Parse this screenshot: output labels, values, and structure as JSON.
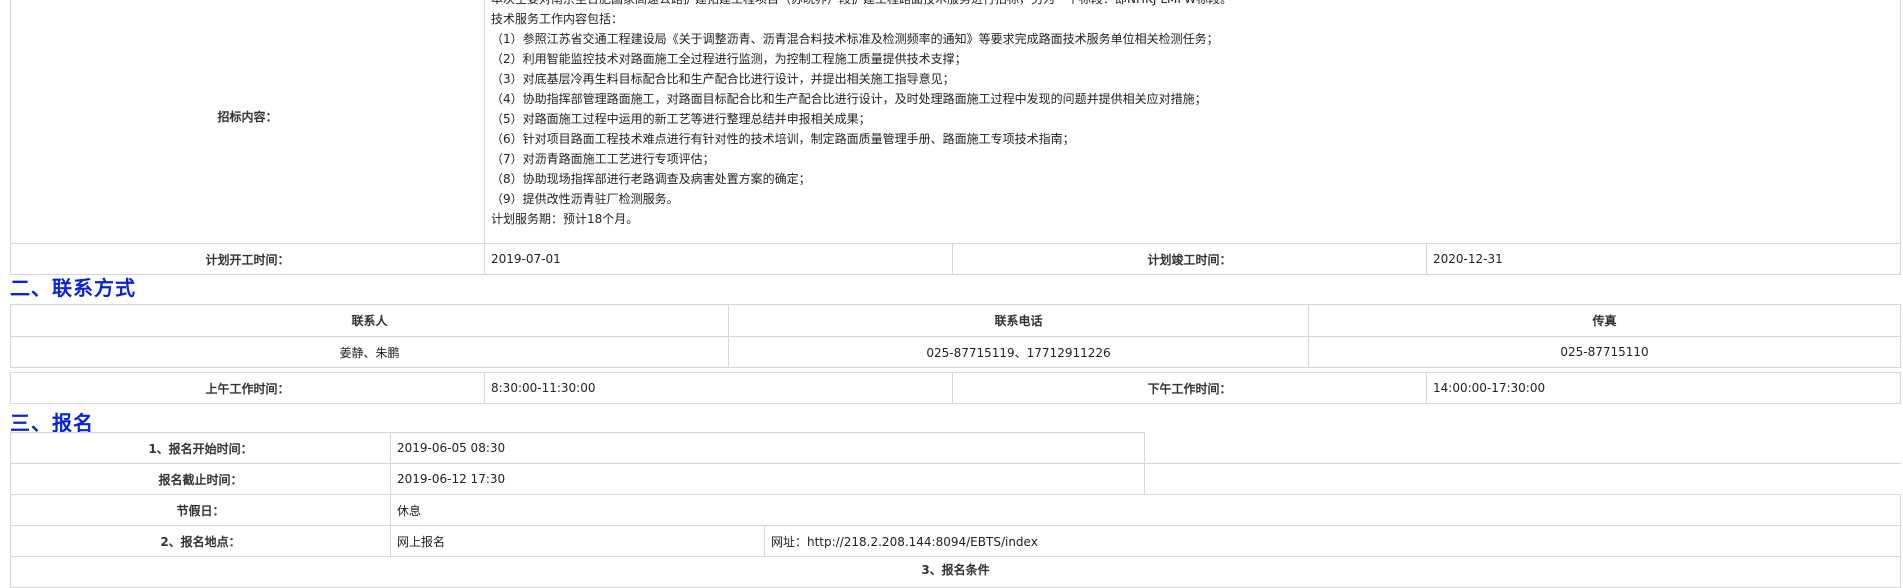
{
  "bid": {
    "label": "招标内容：",
    "lines": [
      "本次主要对南京至合肥国家高速公路扩建拓建工程项目（苏皖界）段扩建工程路面技术服务进行招标，另为一个标段：即NHKJ-LMFW标段。",
      "技术服务工作内容包括：",
      "（1）参照江苏省交通工程建设局《关于调整沥青、沥青混合料技术标准及检测频率的通知》等要求完成路面技术服务单位相关检测任务；",
      "（2）利用智能监控技术对路面施工全过程进行监测，为控制工程施工质量提供技术支撑；",
      "（3）对底基层冷再生料目标配合比和生产配合比进行设计，并提出相关施工指导意见；",
      "（4）协助指挥部管理路面施工，对路面目标配合比和生产配合比进行设计，及时处理路面施工过程中发现的问题并提供相关应对措施；",
      "（5）对路面施工过程中运用的新工艺等进行整理总结并申报相关成果；",
      "（6）针对项目路面工程技术难点进行有针对性的技术培训，制定路面质量管理手册、路面施工专项技术指南；",
      "（7）对沥青路面施工工艺进行专项评估；",
      "（8）协助现场指挥部进行老路调查及病害处置方案的确定；",
      "（9）提供改性沥青驻厂检测服务。",
      "计划服务期：预计18个月。"
    ],
    "plan_start_label": "计划开工时间：",
    "plan_start_value": "2019-07-01",
    "plan_end_label": "计划竣工时间：",
    "plan_end_value": "2020-12-31"
  },
  "contact": {
    "section_title": "二、联系方式",
    "headers": [
      "联系人",
      "联系电话",
      "传真"
    ],
    "values": [
      "姜静、朱鹏",
      "025-87715119、17712911226",
      "025-87715110"
    ],
    "am_label": "上午工作时间：",
    "am_value": "8:30:00-11:30:00",
    "pm_label": "下午工作时间：",
    "pm_value": "14:00:00-17:30:00"
  },
  "signup": {
    "section_title": "三、报名",
    "start_label": "1、报名开始时间：",
    "start_value": "2019-06-05 08:30",
    "end_label": "报名截止时间：",
    "end_value": "2019-06-12 17:30",
    "holiday_label": "节假日：",
    "holiday_value": "休息",
    "place_label": "2、报名地点：",
    "place_value": "网上报名",
    "url_text": "网址：http://218.2.208.144:8094/EBTS/index",
    "conditions_label": "3、报名条件"
  }
}
